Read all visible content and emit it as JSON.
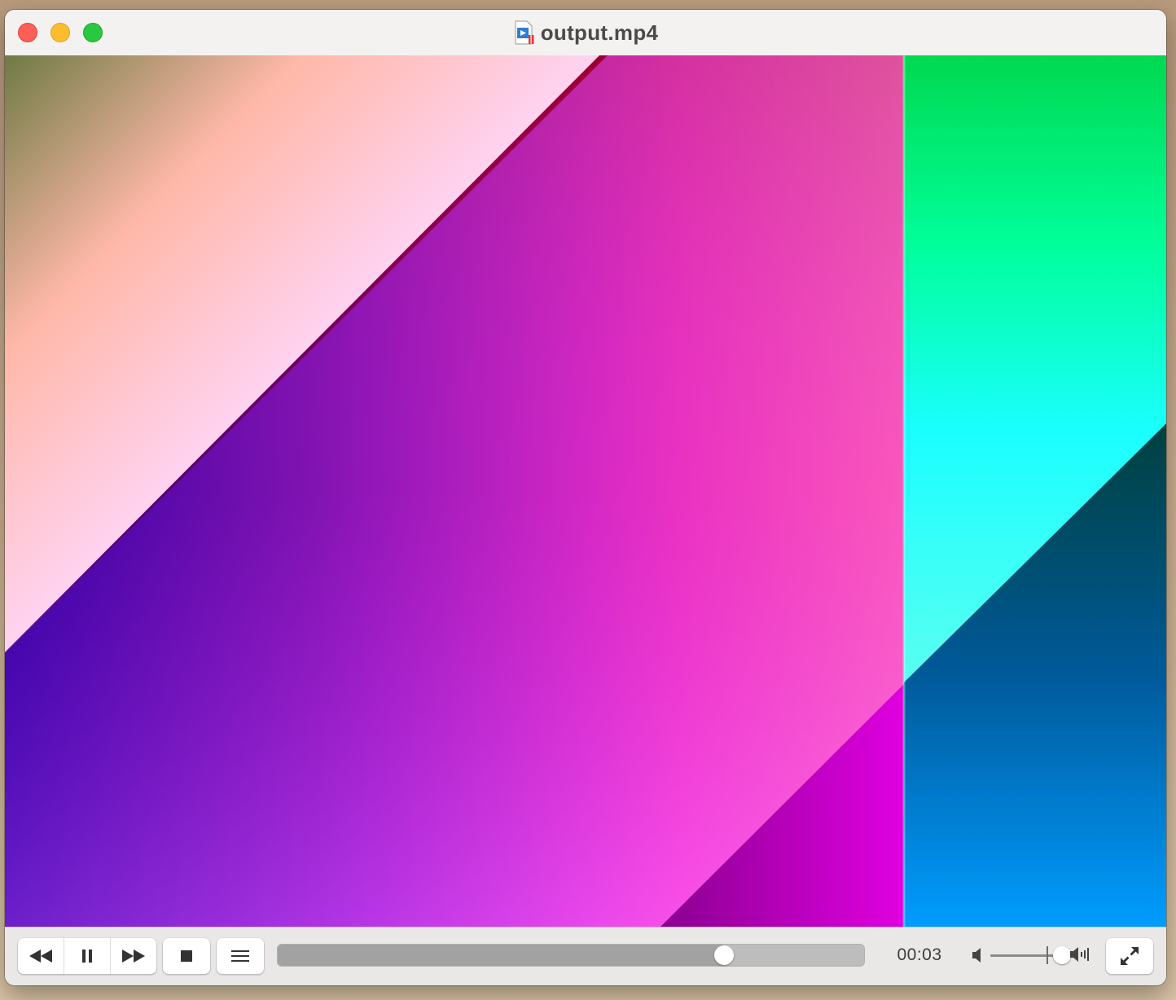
{
  "window": {
    "title": "output.mp4",
    "title_icon": "video-document-icon",
    "traffic_lights": [
      "close-icon",
      "minimize-icon",
      "maximize-icon"
    ]
  },
  "video": {
    "description_colors": {
      "pink": "#ff4dff",
      "red": "#ff1a3c",
      "green": "#00e060",
      "cyan": "#22ffff",
      "blue": "#1a00ff",
      "white": "#ffe0ff"
    }
  },
  "controls": {
    "rewind_icon": "rewind-icon",
    "pause_icon": "pause-icon",
    "fast_forward_icon": "fast-forward-icon",
    "stop_icon": "stop-icon",
    "playlist_icon": "playlist-icon",
    "progress_fraction": 0.76,
    "time": "00:03",
    "volume_low_icon": "volume-low-icon",
    "volume_high_icon": "volume-high-icon",
    "volume_fraction": 0.98,
    "fullscreen_icon": "fullscreen-icon"
  }
}
